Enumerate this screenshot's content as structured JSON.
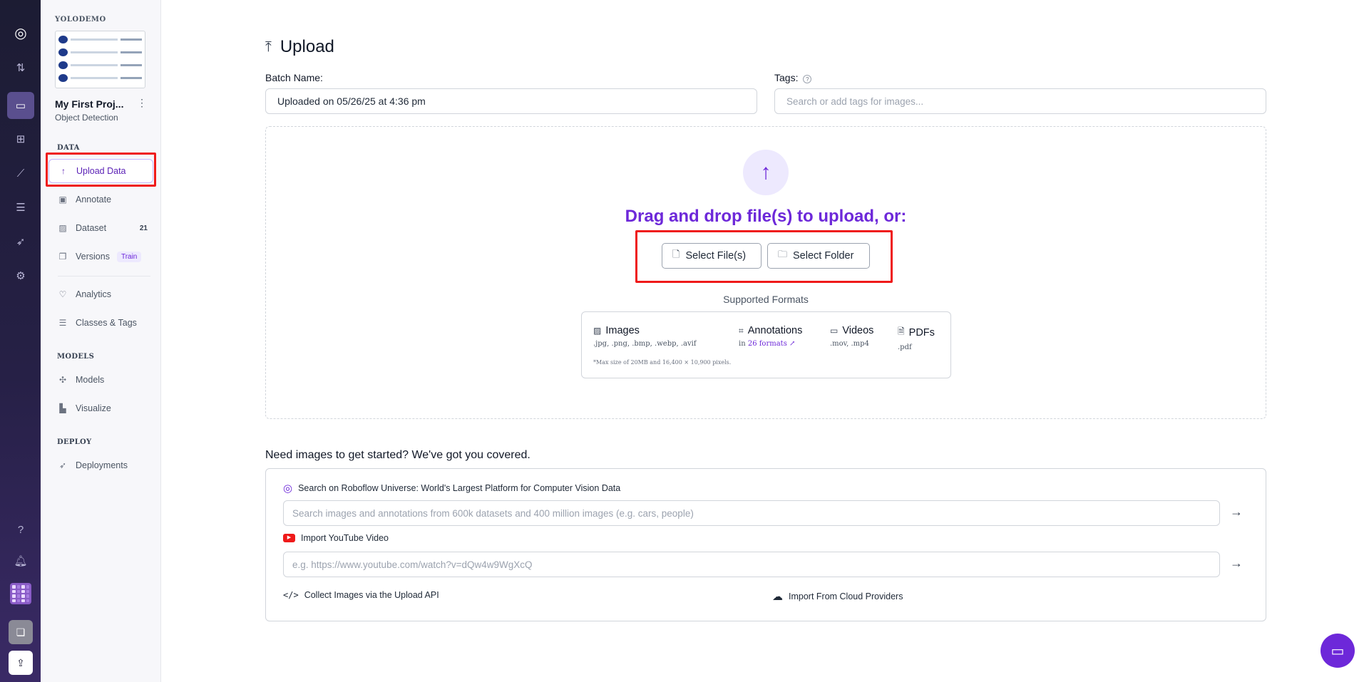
{
  "workspace": {
    "name": "YOLODEMO"
  },
  "project": {
    "name": "My First Proj...",
    "more": "⋮",
    "type": "Object Detection"
  },
  "sidebar": {
    "sections": {
      "data": "DATA",
      "models": "MODELS",
      "deploy": "DEPLOY"
    },
    "items": [
      {
        "label": "Upload Data",
        "icon": "arrow-up-icon",
        "glyph": "↑"
      },
      {
        "label": "Annotate",
        "icon": "annotate-icon",
        "glyph": "▣"
      },
      {
        "label": "Dataset",
        "icon": "image-icon",
        "glyph": "▨",
        "badge": "21"
      },
      {
        "label": "Versions",
        "icon": "versions-icon",
        "glyph": "❐",
        "pill": "Train"
      },
      {
        "label": "Analytics",
        "icon": "analytics-icon",
        "glyph": "♡"
      },
      {
        "label": "Classes & Tags",
        "icon": "list-icon",
        "glyph": "☰"
      },
      {
        "label": "Models",
        "icon": "models-icon",
        "glyph": "✣"
      },
      {
        "label": "Visualize",
        "icon": "chart-icon",
        "glyph": "▙"
      },
      {
        "label": "Deployments",
        "icon": "rocket-icon",
        "glyph": "➶"
      }
    ]
  },
  "page": {
    "title": "Upload",
    "title_icon": "⤒"
  },
  "form": {
    "batch_label": "Batch Name:",
    "batch_value": "Uploaded on 05/26/25 at 4:36 pm",
    "tags_label": "Tags:",
    "tags_help": "?",
    "tags_placeholder": "Search or add tags for images..."
  },
  "dropzone": {
    "upload_glyph": "↑",
    "text": "Drag and drop file(s) to upload, or:",
    "select_files": "Select File(s)",
    "select_folder": "Select Folder",
    "file_glyph": "🗋",
    "folder_glyph": "🗀",
    "supported_title": "Supported Formats",
    "formats": {
      "images": {
        "title": "Images",
        "ext": ".jpg, .png, .bmp, .webp, .avif"
      },
      "annotations": {
        "title": "Annotations",
        "prefix": "in",
        "link": "26 formats ↗"
      },
      "videos": {
        "title": "Videos",
        "ext": ".mov, .mp4"
      },
      "pdfs": {
        "title": "PDFs",
        "ext": ".pdf"
      }
    },
    "note": "*Max size of 20MB and 16,400 × 10,900 pixels."
  },
  "sources": {
    "heading": "Need images to get started? We've got you covered.",
    "universe_label": "Search on Roboflow Universe: World's Largest Platform for Computer Vision Data",
    "universe_placeholder": "Search images and annotations from 600k datasets and 400 million images (e.g. cars, people)",
    "youtube_label": "Import YouTube Video",
    "youtube_placeholder": "e.g. https://www.youtube.com/watch?v=dQw4w9WgXcQ",
    "api_label": "Collect Images via the Upload API",
    "cloud_label": "Import From Cloud Providers",
    "arrow": "→"
  },
  "colors": {
    "accent": "#6d28d9",
    "highlight": "#ef1a1a",
    "rail": "#1c1c33"
  }
}
